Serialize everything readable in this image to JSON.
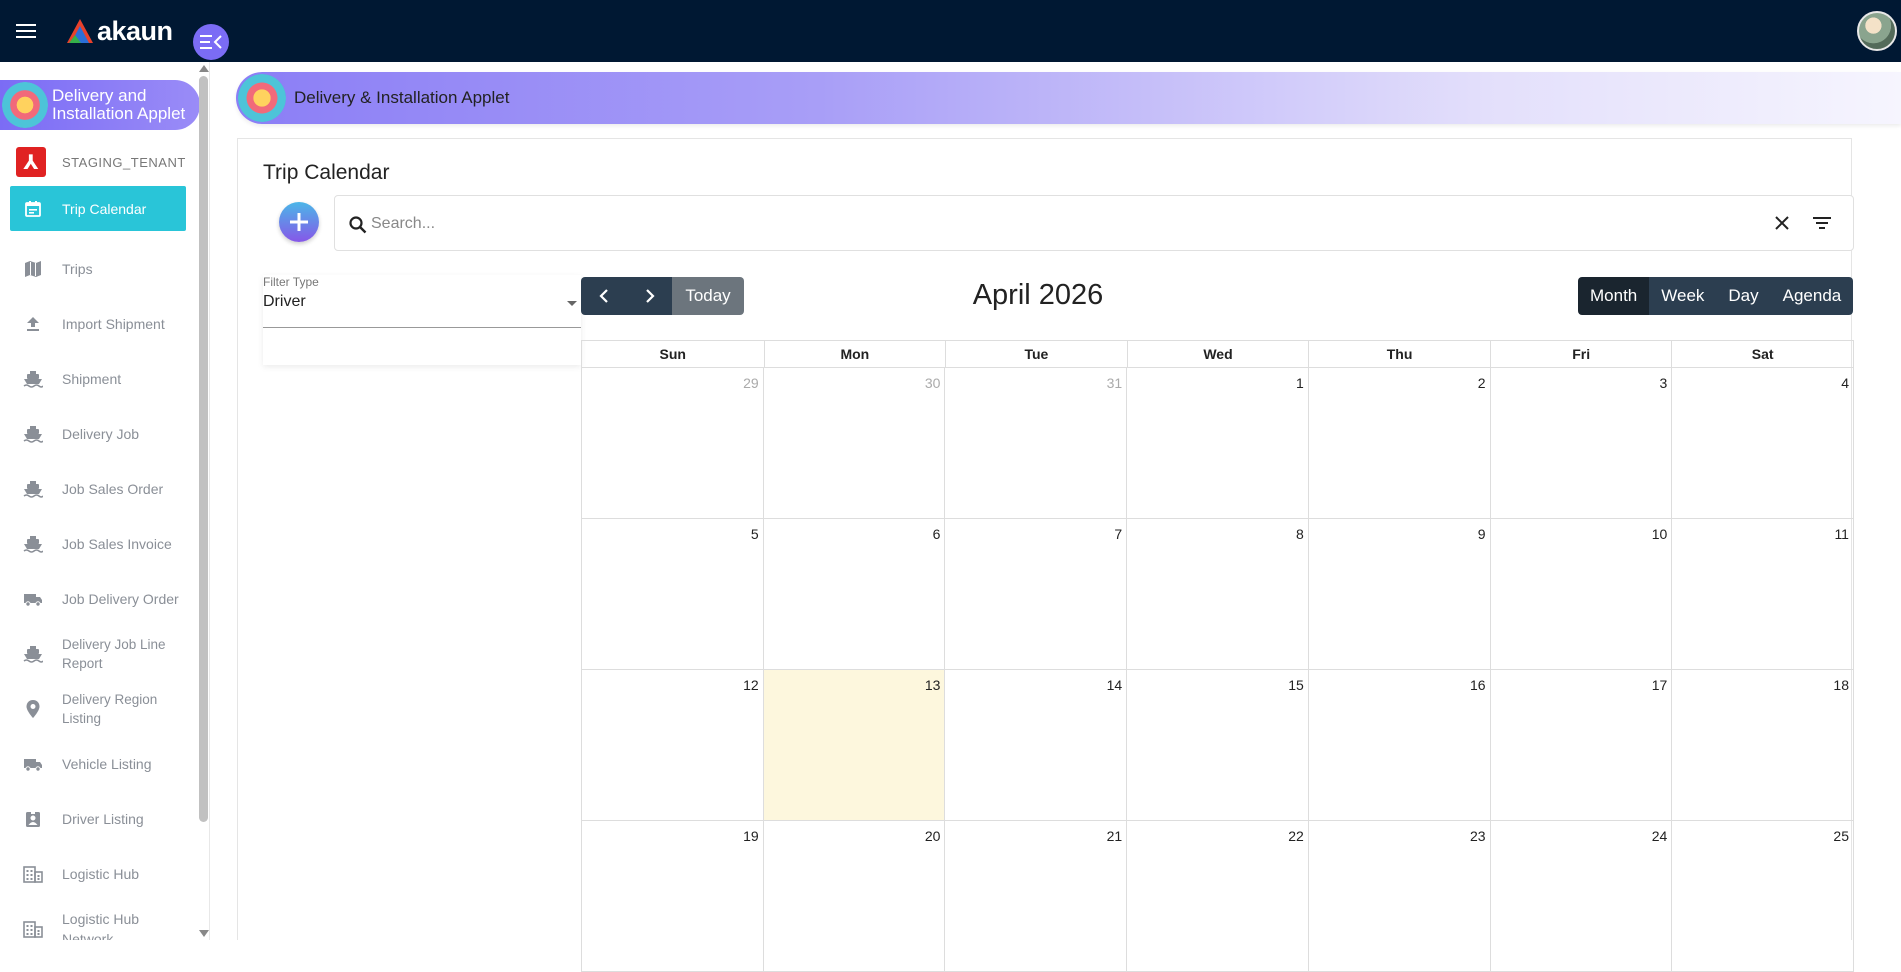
{
  "brand": {
    "name": "akaun"
  },
  "applet": {
    "sidebar_name": "Delivery and Installation Applet",
    "band_title": "Delivery & Installation Applet"
  },
  "tenant": {
    "name": "STAGING_TENANT"
  },
  "nav": [
    {
      "label": "Trip Calendar",
      "icon": "calendar-icon",
      "active": true
    },
    {
      "label": "Trips",
      "icon": "map-icon"
    },
    {
      "label": "Import Shipment",
      "icon": "upload-icon"
    },
    {
      "label": "Shipment",
      "icon": "ship-icon"
    },
    {
      "label": "Delivery Job",
      "icon": "ship-icon"
    },
    {
      "label": "Job Sales Order",
      "icon": "ship-icon"
    },
    {
      "label": "Job Sales Invoice",
      "icon": "ship-icon"
    },
    {
      "label": "Job Delivery Order",
      "icon": "truck-icon"
    },
    {
      "label": "Delivery Job Line Report",
      "icon": "ship-icon"
    },
    {
      "label": "Delivery Region Listing",
      "icon": "location-icon"
    },
    {
      "label": "Vehicle Listing",
      "icon": "truck-icon"
    },
    {
      "label": "Driver Listing",
      "icon": "badge-icon"
    },
    {
      "label": "Logistic Hub",
      "icon": "building-icon"
    },
    {
      "label": "Logistic Hub Network",
      "icon": "building-icon"
    }
  ],
  "page": {
    "title": "Trip Calendar",
    "search_placeholder": "Search...",
    "filter": {
      "label": "Filter Type",
      "value": "Driver"
    }
  },
  "calendar": {
    "today_label": "Today",
    "title": "April 2026",
    "views": [
      "Month",
      "Week",
      "Day",
      "Agenda"
    ],
    "active_view": "Month",
    "weekdays": [
      "Sun",
      "Mon",
      "Tue",
      "Wed",
      "Thu",
      "Fri",
      "Sat"
    ],
    "days": [
      {
        "n": "29",
        "off": true
      },
      {
        "n": "30",
        "off": true
      },
      {
        "n": "31",
        "off": true
      },
      {
        "n": "1"
      },
      {
        "n": "2"
      },
      {
        "n": "3"
      },
      {
        "n": "4"
      },
      {
        "n": "5"
      },
      {
        "n": "6"
      },
      {
        "n": "7"
      },
      {
        "n": "8"
      },
      {
        "n": "9"
      },
      {
        "n": "10"
      },
      {
        "n": "11"
      },
      {
        "n": "12"
      },
      {
        "n": "13",
        "today": true
      },
      {
        "n": "14"
      },
      {
        "n": "15"
      },
      {
        "n": "16"
      },
      {
        "n": "17"
      },
      {
        "n": "18"
      },
      {
        "n": "19"
      },
      {
        "n": "20"
      },
      {
        "n": "21"
      },
      {
        "n": "22"
      },
      {
        "n": "23"
      },
      {
        "n": "24"
      },
      {
        "n": "25"
      }
    ]
  },
  "colors": {
    "topbar": "#001833",
    "active_nav": "#29c5d8",
    "applet_purple": "#7b6cf5",
    "today_cell": "#fdf7dd",
    "calendar_button": "#2c3e50"
  }
}
